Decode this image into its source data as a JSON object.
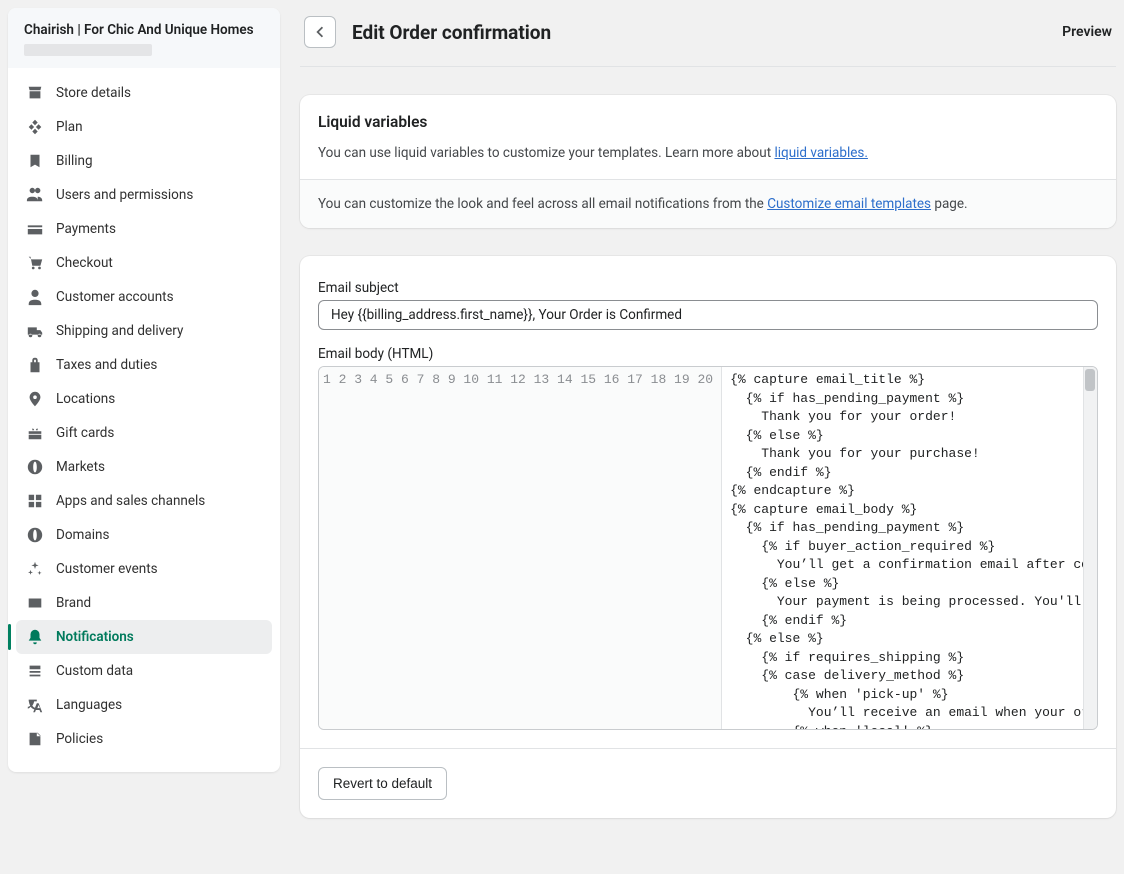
{
  "sidebar": {
    "title": "Chairish | For Chic And Unique Homes",
    "items": [
      {
        "label": "Store details",
        "icon": "store-icon"
      },
      {
        "label": "Plan",
        "icon": "plan-icon"
      },
      {
        "label": "Billing",
        "icon": "billing-icon"
      },
      {
        "label": "Users and permissions",
        "icon": "users-icon"
      },
      {
        "label": "Payments",
        "icon": "payments-icon"
      },
      {
        "label": "Checkout",
        "icon": "checkout-icon"
      },
      {
        "label": "Customer accounts",
        "icon": "customers-icon"
      },
      {
        "label": "Shipping and delivery",
        "icon": "shipping-icon"
      },
      {
        "label": "Taxes and duties",
        "icon": "taxes-icon"
      },
      {
        "label": "Locations",
        "icon": "locations-icon"
      },
      {
        "label": "Gift cards",
        "icon": "giftcards-icon"
      },
      {
        "label": "Markets",
        "icon": "markets-icon"
      },
      {
        "label": "Apps and sales channels",
        "icon": "apps-icon"
      },
      {
        "label": "Domains",
        "icon": "domains-icon"
      },
      {
        "label": "Customer events",
        "icon": "events-icon"
      },
      {
        "label": "Brand",
        "icon": "brand-icon"
      },
      {
        "label": "Notifications",
        "icon": "notifications-icon",
        "active": true
      },
      {
        "label": "Custom data",
        "icon": "customdata-icon"
      },
      {
        "label": "Languages",
        "icon": "languages-icon"
      },
      {
        "label": "Policies",
        "icon": "policies-icon"
      }
    ]
  },
  "header": {
    "title": "Edit Order confirmation",
    "preview": "Preview"
  },
  "liquid_card": {
    "heading": "Liquid variables",
    "desc_pre": "You can use liquid variables to customize your templates. Learn more about ",
    "link": "liquid variables.",
    "sub_pre": "You can customize the look and feel across all email notifications from the ",
    "sub_link": "Customize email templates",
    "sub_post": " page."
  },
  "email_card": {
    "subject_label": "Email subject",
    "subject_value": "Hey {{billing_address.first_name}}, Your Order is Confirmed",
    "body_label": "Email body (HTML)",
    "code_lines": [
      "{% capture email_title %}",
      "  {% if has_pending_payment %}",
      "    Thank you for your order!",
      "  {% else %}",
      "    Thank you for your purchase!",
      "  {% endif %}",
      "{% endcapture %}",
      "{% capture email_body %}",
      "  {% if has_pending_payment %}",
      "    {% if buyer_action_required %}",
      "      You’ll get a confirmation email after completing your payment.",
      "    {% else %}",
      "      Your payment is being processed. You'll get an email when your order is confirmed.",
      "    {% endif %}",
      "  {% else %}",
      "    {% if requires_shipping %}",
      "    {% case delivery_method %}",
      "        {% when 'pick-up' %}",
      "          You’ll receive an email when your order is ready for pickup.",
      "        {% when 'local' %}"
    ],
    "revert_label": "Revert to default"
  }
}
